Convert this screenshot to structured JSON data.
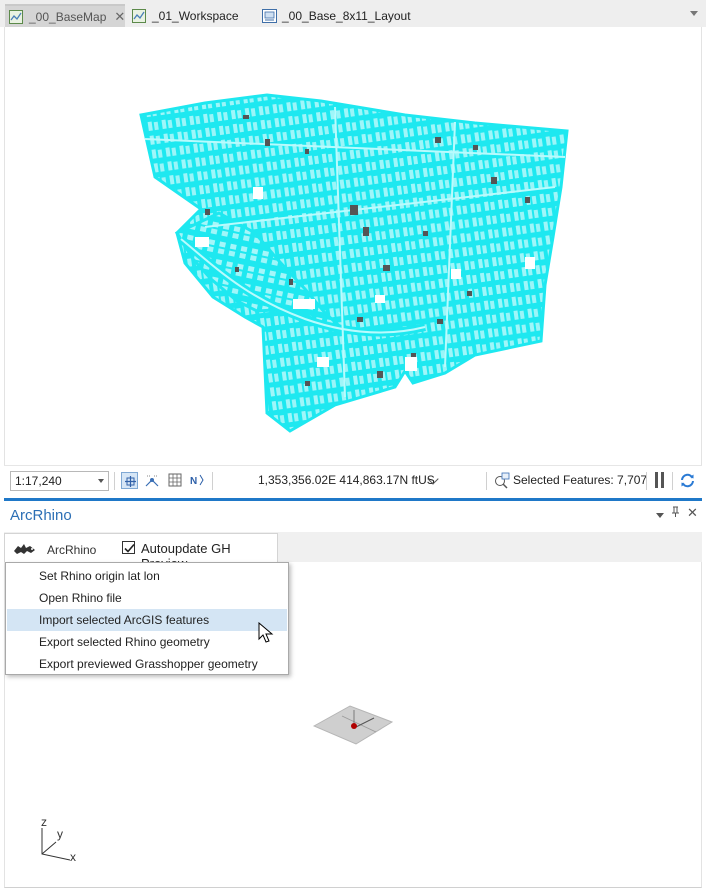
{
  "tabs": [
    {
      "label": "_00_BaseMap",
      "icon": "map-icon",
      "active": true
    },
    {
      "label": "_01_Workspace",
      "icon": "map-icon",
      "active": false
    },
    {
      "label": "_00_Base_8x11_Layout",
      "icon": "layout-icon",
      "active": false
    }
  ],
  "tab_close_glyph": "✕",
  "statusbar": {
    "scale": "1:17,240",
    "coordinates": "1,353,356.02E 414,863.17N ftUS",
    "selected_features": "Selected Features: 7,707"
  },
  "pane": {
    "title": "ArcRhino",
    "toolbar_label": "ArcRhino",
    "autoupdate_label": "Autoupdate GH Preview",
    "autoupdate_checked": true
  },
  "menu": {
    "items": [
      "Set Rhino origin lat lon",
      "Open Rhino file",
      "Import selected ArcGIS features",
      "Export selected Rhino geometry",
      "Export previewed Grasshopper geometry"
    ],
    "hover_index": 2
  },
  "axes": {
    "z": "z",
    "y": "y",
    "x": "x"
  },
  "colors": {
    "map_features": "#1ee8f0",
    "buildings": "#555555",
    "accent": "#1f78c8",
    "menu_hover": "#d4e5f4",
    "rhino_origin": "#b00000"
  }
}
